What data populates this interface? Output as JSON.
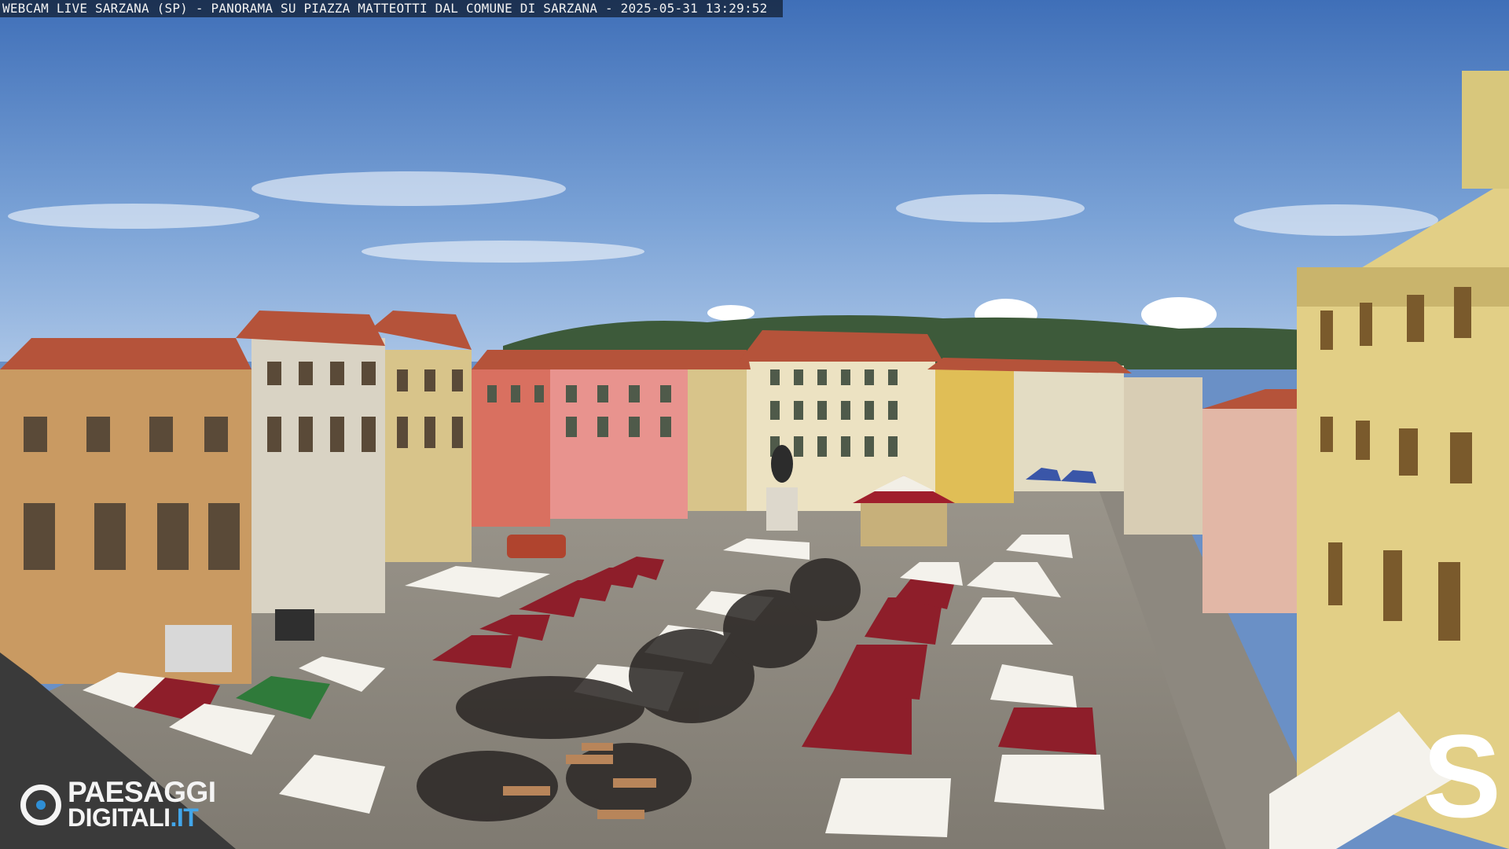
{
  "overlay": {
    "caption": "WEBCAM LIVE SARZANA (SP) - PANORAMA SU PIAZZA MATTEOTTI DAL COMUNE DI SARZANA - 2025-05-31  13:29:52"
  },
  "logo": {
    "word1": "PAESAGGI",
    "word2": "DIGITALI",
    "tld": ".IT",
    "ring_icon": "lens-ring-icon",
    "accent": "#42a6ea"
  },
  "brand_mark": {
    "letter": "S",
    "color": "#ffffff"
  },
  "colors": {
    "sky": "#5e88c4",
    "stall_red": "#8e1e2a",
    "stall_white": "#f4f2ec",
    "stall_green": "#2f7a3a"
  }
}
